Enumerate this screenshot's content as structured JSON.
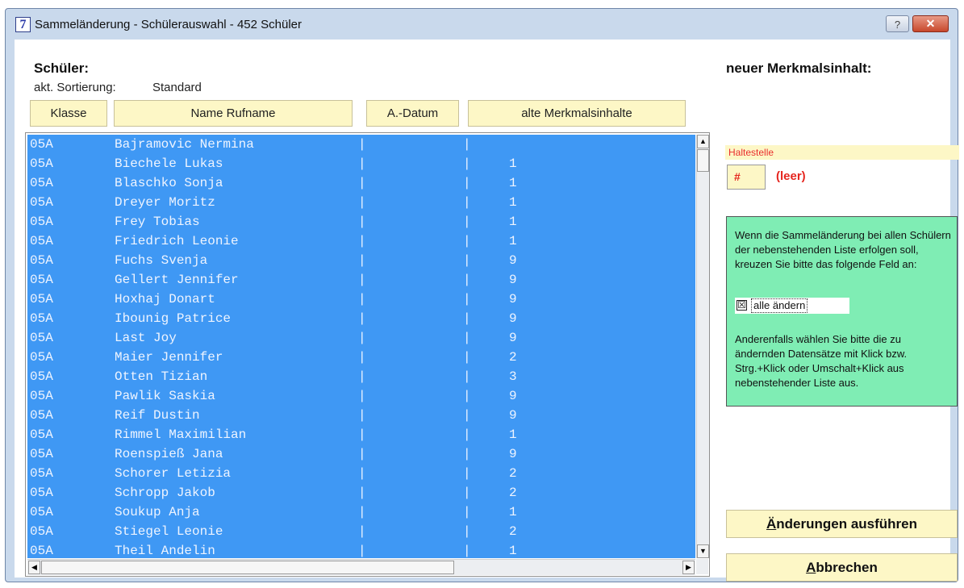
{
  "window": {
    "app_icon_glyph": "7",
    "title": "Sammeländerung - Schülerauswahl - 452 Schüler",
    "help_label": "?",
    "close_label": "✕"
  },
  "left": {
    "heading": "Schüler:",
    "sort_label": "akt. Sortierung:",
    "sort_value": "Standard"
  },
  "right": {
    "heading": "neuer Merkmalsinhalt:",
    "field_label": "Haltestelle",
    "field_value": "#",
    "field_value_text": "(leer)"
  },
  "columns": [
    "Klasse",
    "Name Rufname",
    "A.-Datum",
    "alte Merkmalsinhalte"
  ],
  "rows": [
    {
      "klasse": "05A",
      "name": "Bajramovic Nermina",
      "sep1": "|",
      "sep2": "|",
      "value": ""
    },
    {
      "klasse": "05A",
      "name": "Biechele Lukas",
      "sep1": "|",
      "sep2": "|",
      "value": "1"
    },
    {
      "klasse": "05A",
      "name": "Blaschko Sonja",
      "sep1": "|",
      "sep2": "|",
      "value": "1"
    },
    {
      "klasse": "05A",
      "name": "Dreyer Moritz",
      "sep1": "|",
      "sep2": "|",
      "value": "1"
    },
    {
      "klasse": "05A",
      "name": "Frey Tobias",
      "sep1": "|",
      "sep2": "|",
      "value": "1"
    },
    {
      "klasse": "05A",
      "name": "Friedrich Leonie",
      "sep1": "|",
      "sep2": "|",
      "value": "1"
    },
    {
      "klasse": "05A",
      "name": "Fuchs Svenja",
      "sep1": "|",
      "sep2": "|",
      "value": "9"
    },
    {
      "klasse": "05A",
      "name": "Gellert Jennifer",
      "sep1": "|",
      "sep2": "|",
      "value": "9"
    },
    {
      "klasse": "05A",
      "name": "Hoxhaj Donart",
      "sep1": "|",
      "sep2": "|",
      "value": "9"
    },
    {
      "klasse": "05A",
      "name": "Ibounig Patrice",
      "sep1": "|",
      "sep2": "|",
      "value": "9"
    },
    {
      "klasse": "05A",
      "name": "Last Joy",
      "sep1": "|",
      "sep2": "|",
      "value": "9"
    },
    {
      "klasse": "05A",
      "name": "Maier Jennifer",
      "sep1": "|",
      "sep2": "|",
      "value": "2"
    },
    {
      "klasse": "05A",
      "name": "Otten Tizian",
      "sep1": "|",
      "sep2": "|",
      "value": "3"
    },
    {
      "klasse": "05A",
      "name": "Pawlik Saskia",
      "sep1": "|",
      "sep2": "|",
      "value": "9"
    },
    {
      "klasse": "05A",
      "name": "Reif Dustin",
      "sep1": "|",
      "sep2": "|",
      "value": "9"
    },
    {
      "klasse": "05A",
      "name": "Rimmel Maximilian",
      "sep1": "|",
      "sep2": "|",
      "value": "1"
    },
    {
      "klasse": "05A",
      "name": "Roenspieß Jana",
      "sep1": "|",
      "sep2": "|",
      "value": "9"
    },
    {
      "klasse": "05A",
      "name": "Schorer Letizia",
      "sep1": "|",
      "sep2": "|",
      "value": "2"
    },
    {
      "klasse": "05A",
      "name": "Schropp Jakob",
      "sep1": "|",
      "sep2": "|",
      "value": "2"
    },
    {
      "klasse": "05A",
      "name": "Soukup Anja",
      "sep1": "|",
      "sep2": "|",
      "value": "1"
    },
    {
      "klasse": "05A",
      "name": "Stiegel Leonie",
      "sep1": "|",
      "sep2": "|",
      "value": "2"
    },
    {
      "klasse": "05A",
      "name": "Theil Andelin",
      "sep1": "|",
      "sep2": "|",
      "value": "1"
    }
  ],
  "scrollbar": {
    "up_arrow": "▲",
    "down_arrow": "▼",
    "left_arrow": "◀",
    "right_arrow": "▶"
  },
  "info": {
    "text_1": "Wenn die Sammeländerung bei allen Schülern der nebenstehenden Liste erfolgen soll, kreuzen Sie bitte das folgende Feld an:",
    "checkbox_mark": "☒",
    "checkbox_label": "alle ändern",
    "text_2": "Anderenfalls wählen Sie bitte die zu ändernden Datensätze mit Klick bzw. Strg.+Klick oder Umschalt+Klick aus nebenstehender Liste  aus."
  },
  "buttons": {
    "execute_mnemonic": "Ä",
    "execute_rest": "nderungen ausführen",
    "cancel_mnemonic": "A",
    "cancel_rest": "bbrechen"
  },
  "colors": {
    "selection": "#3f98f4",
    "button_face": "#fdf7c6",
    "info_panel": "#7fedb4",
    "accent_red": "#e5261f"
  }
}
